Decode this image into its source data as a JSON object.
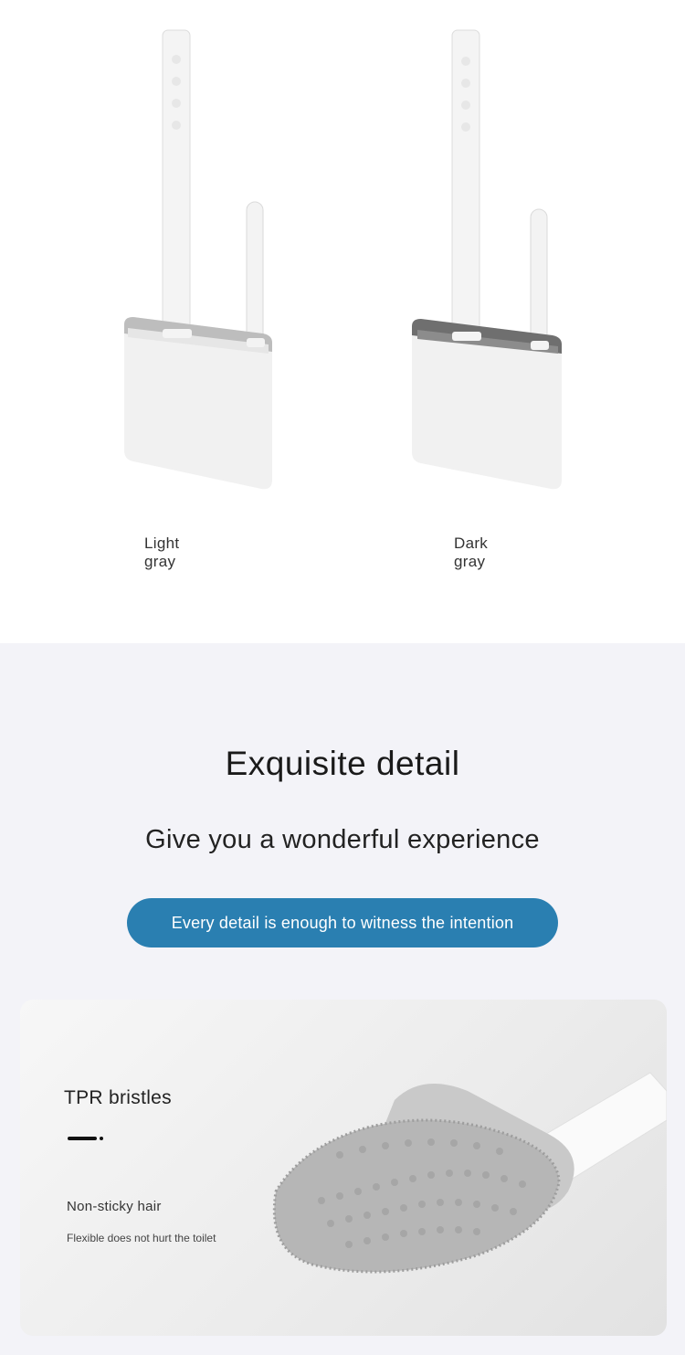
{
  "colors": {
    "light_gray_rim": "#bdbdbd",
    "dark_gray_rim": "#6f6f6f",
    "pill_bg": "#2a7fb1",
    "section_bg": "#f3f3f8"
  },
  "variants": [
    {
      "label": "Light gray",
      "icon": "moon-icon"
    },
    {
      "label": "Dark gray",
      "icon": "moon-icon"
    }
  ],
  "detail_section": {
    "title": "Exquisite detail",
    "subtitle": "Give you a wonderful experience",
    "pill_text": "Every detail is enough to witness the intention"
  },
  "feature_card": {
    "heading": "TPR bristles",
    "sub_heading": "Non-sticky hair",
    "description": "Flexible does not hurt the toilet"
  }
}
